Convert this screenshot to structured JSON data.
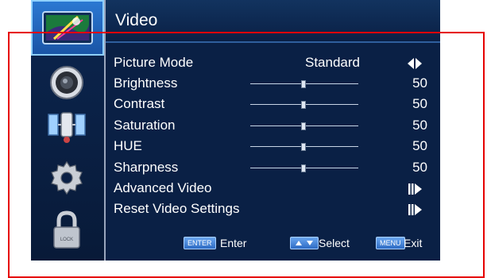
{
  "title": "Video",
  "sidebar": {
    "items": [
      {
        "icon": "picture-icon",
        "active": true
      },
      {
        "icon": "speaker-icon",
        "active": false
      },
      {
        "icon": "satellite-icon",
        "active": false
      },
      {
        "icon": "settings-gear-icon",
        "active": false
      },
      {
        "icon": "lock-icon",
        "active": false
      }
    ],
    "lock_text": "LOCK"
  },
  "menu": {
    "picture_mode": {
      "label": "Picture Mode",
      "value": "Standard"
    },
    "brightness": {
      "label": "Brightness",
      "value": "50",
      "level": 0.5
    },
    "contrast": {
      "label": "Contrast",
      "value": "50",
      "level": 0.5
    },
    "saturation": {
      "label": "Saturation",
      "value": "50",
      "level": 0.5
    },
    "hue": {
      "label": "HUE",
      "value": "50",
      "level": 0.5
    },
    "sharpness": {
      "label": "Sharpness",
      "value": "50",
      "level": 0.5
    },
    "advanced_video": {
      "label": "Advanced Video"
    },
    "reset_video": {
      "label": "Reset Video Settings"
    }
  },
  "footer": {
    "enter_chip": "ENTER",
    "enter_label": "Enter",
    "select_label": "Select",
    "menu_chip": "MENU",
    "exit_label": "Exit"
  },
  "colors": {
    "panel_bg": "#0a2045",
    "highlight": "#2b78d2",
    "outline": "#e60000"
  }
}
